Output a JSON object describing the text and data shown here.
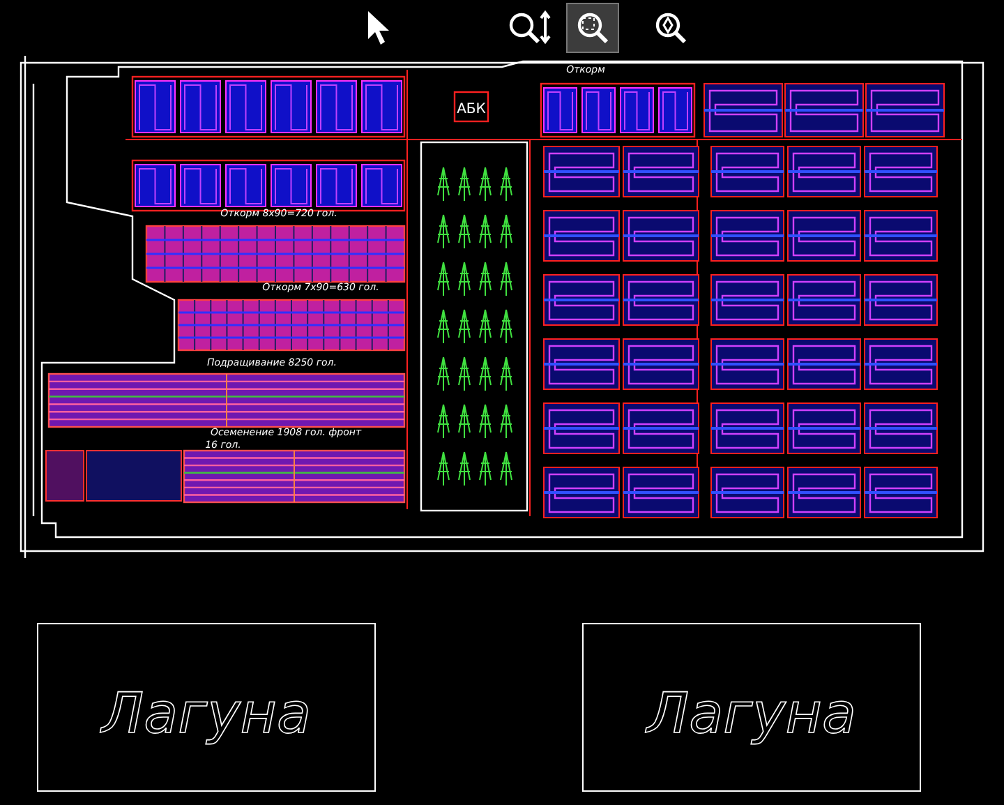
{
  "toolbar": {
    "tools": [
      {
        "kind": "select",
        "selected": false
      },
      {
        "kind": "zoom-extents",
        "selected": false
      },
      {
        "kind": "zoom-window",
        "selected": true
      },
      {
        "kind": "zoom",
        "selected": false
      }
    ]
  },
  "plan": {
    "office": "АБК",
    "labels": [
      {
        "text": "Откорм 8х90=720 гол."
      },
      {
        "text": "Откорм 7х90=630 гол."
      },
      {
        "text": "Подращивание 8250 гол."
      },
      {
        "text": "Осеменение 1908 гол. фронт"
      },
      {
        "text": "16 гол."
      },
      {
        "text": "Откорм"
      }
    ]
  },
  "lagoons": [
    {
      "label": "Лагуна"
    },
    {
      "label": "Лагуна"
    }
  ]
}
